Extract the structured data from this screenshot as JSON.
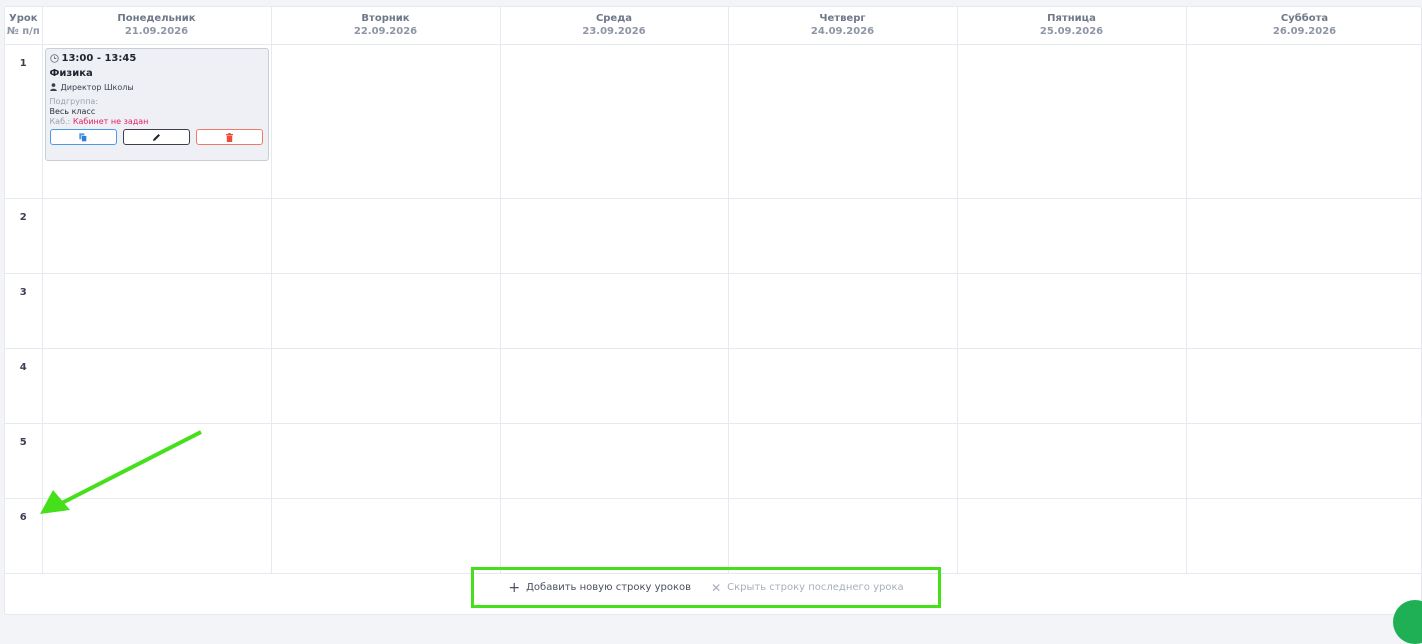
{
  "header": {
    "lesson_col": {
      "title": "Урок",
      "subtitle": "№ п/п"
    },
    "days": [
      {
        "name": "Понедельник",
        "date": "21.09.2026"
      },
      {
        "name": "Вторник",
        "date": "22.09.2026"
      },
      {
        "name": "Среда",
        "date": "23.09.2026"
      },
      {
        "name": "Четверг",
        "date": "24.09.2026"
      },
      {
        "name": "Пятница",
        "date": "25.09.2026"
      },
      {
        "name": "Суббота",
        "date": "26.09.2026"
      }
    ]
  },
  "rows": [
    "1",
    "2",
    "3",
    "4",
    "5",
    "6"
  ],
  "lesson": {
    "time": "13:00 - 13:45",
    "subject": "Физика",
    "teacher": "Директор Школы",
    "subgroup_label": "Подгруппа:",
    "subgroup_value": "Весь класс",
    "room_label": "Каб.:",
    "room_value": "Кабинет не задан",
    "icons": {
      "time": "clock-icon",
      "teacher": "user-icon",
      "copy": "copy-icon",
      "edit": "pencil-icon",
      "delete": "trash-icon"
    },
    "colors": {
      "copy": "#4a9ae8",
      "edit": "#3a3f48",
      "delete": "#ef7a6a",
      "room_missing": "#e0245e"
    }
  },
  "footer": {
    "add_row_label": "Добавить новую строку уроков",
    "hide_row_label": "Скрыть строку последнего урока",
    "icons": {
      "add": "plus-icon",
      "hide": "x-icon"
    }
  },
  "annotation": {
    "color": "#45e01a"
  }
}
